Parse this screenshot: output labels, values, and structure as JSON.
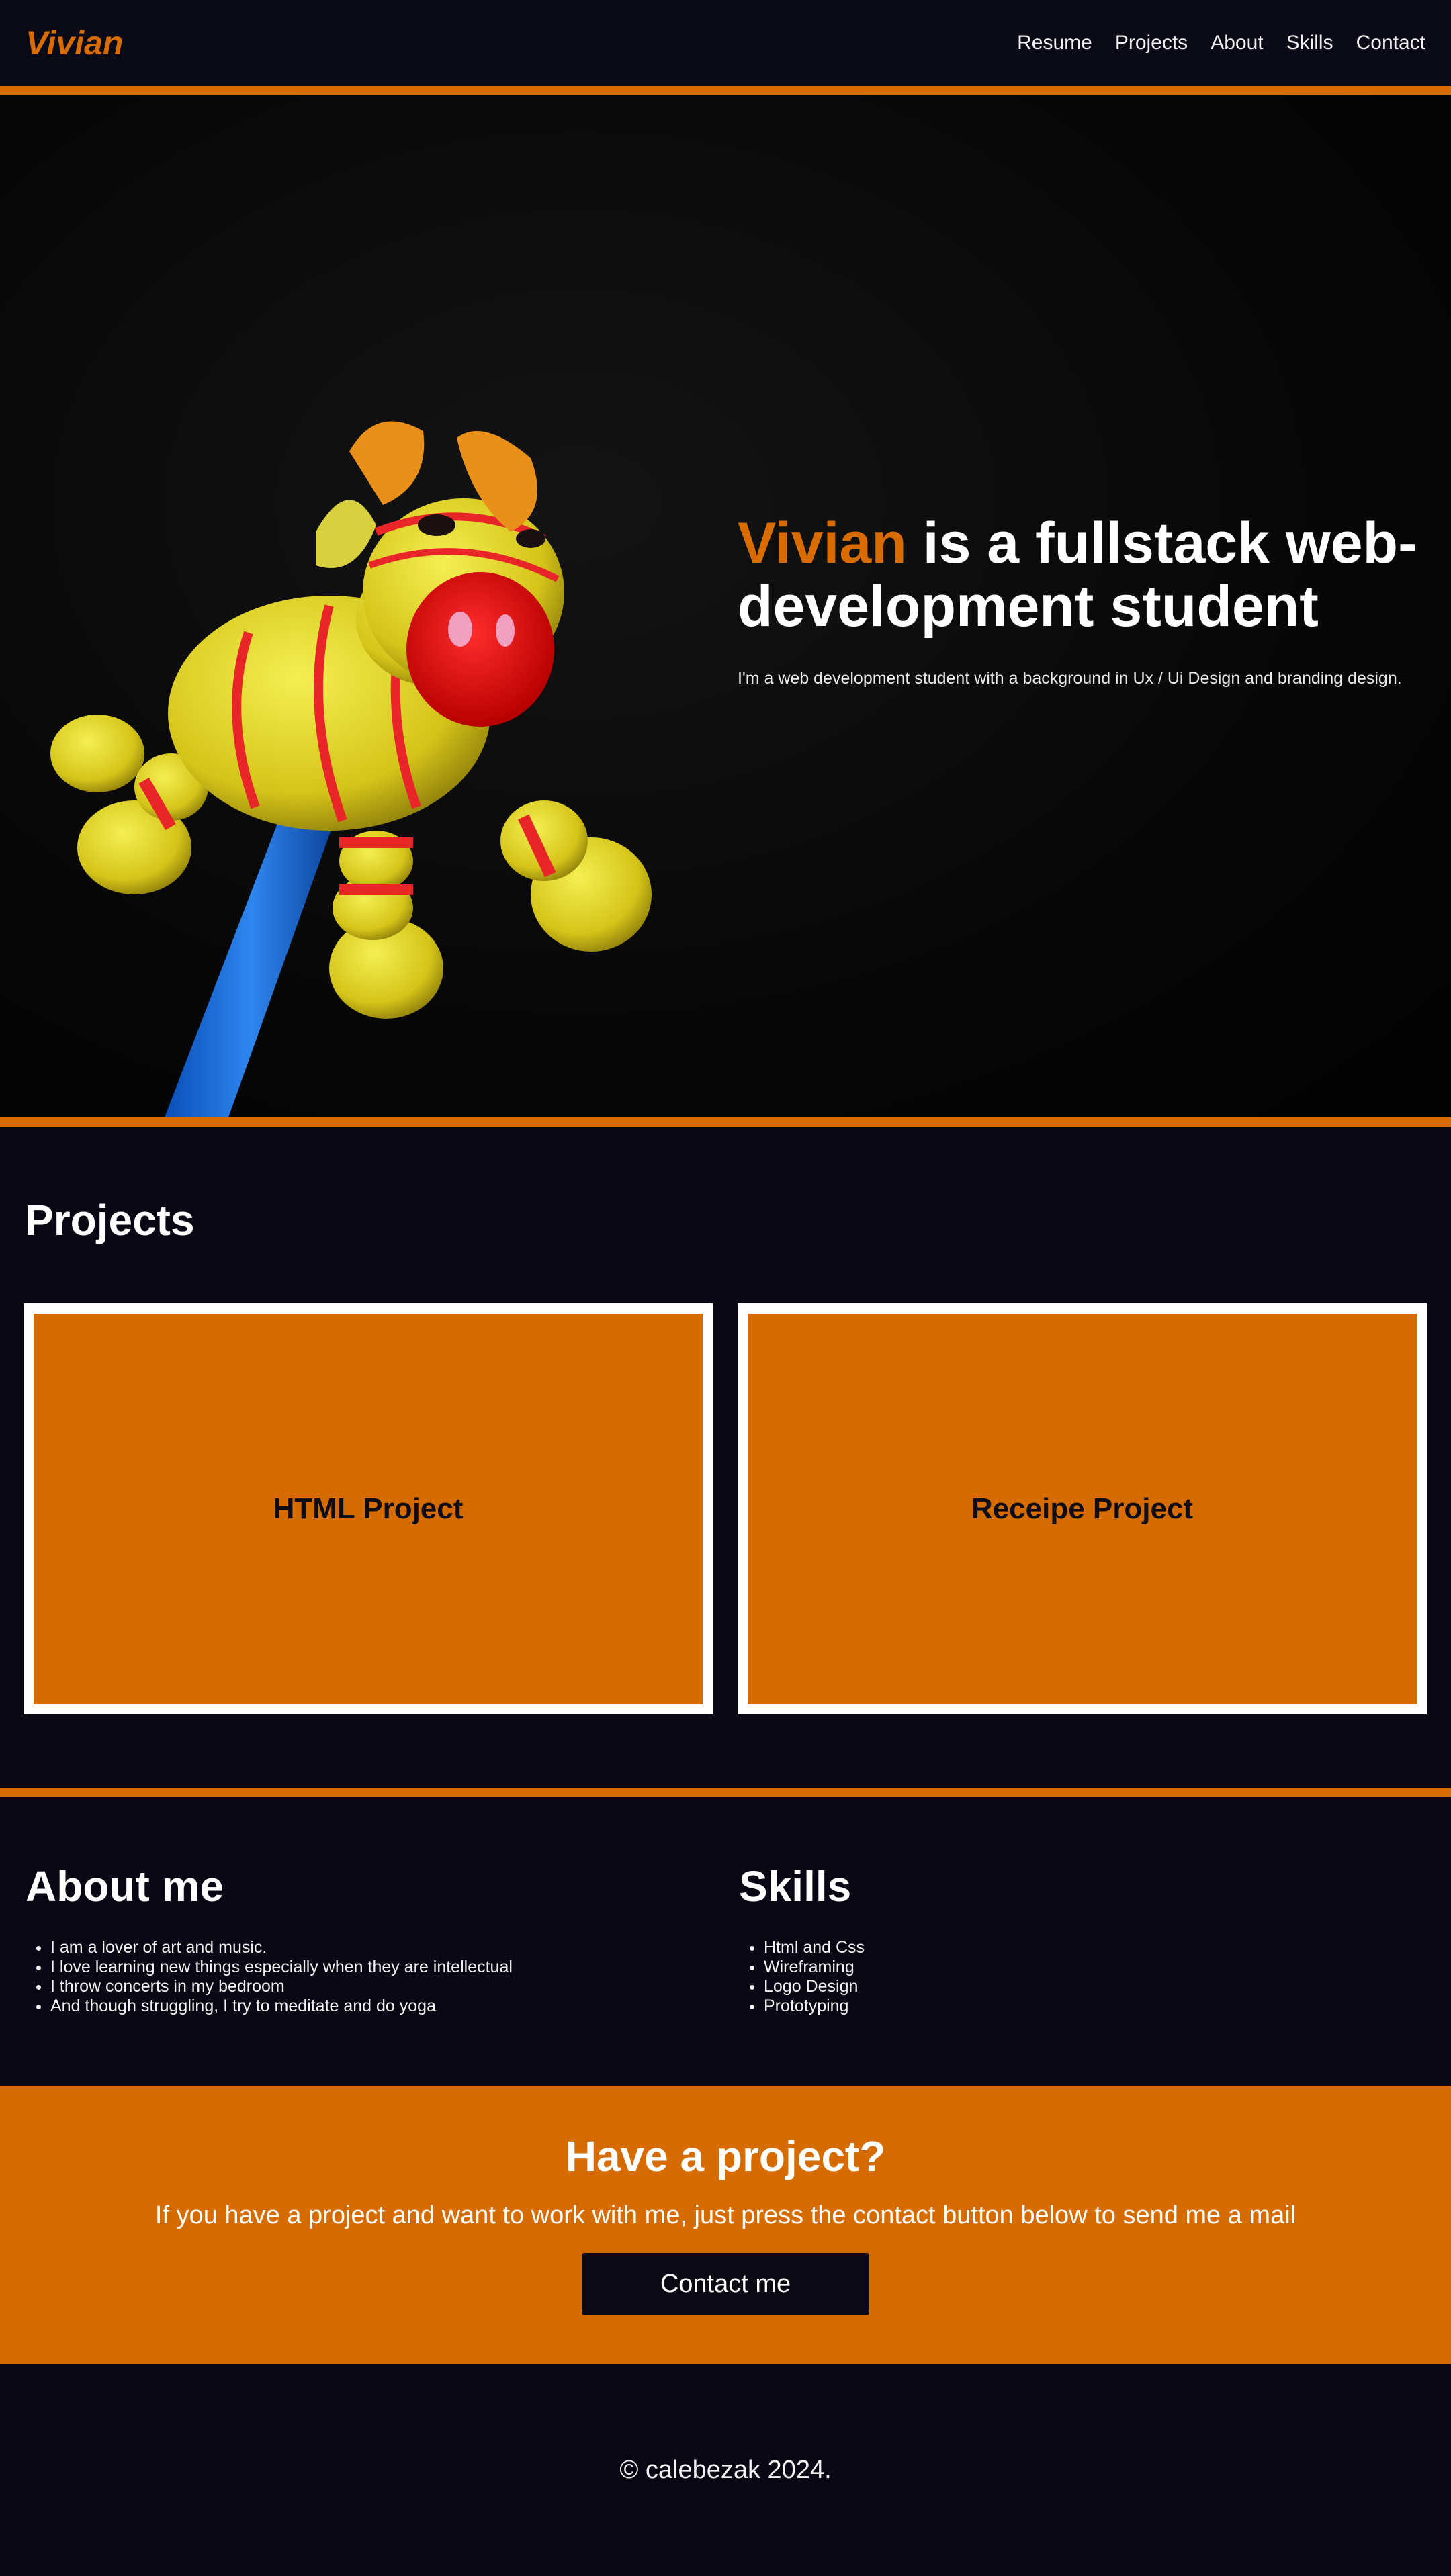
{
  "nav": {
    "logo": "Vivian",
    "links": [
      "Resume",
      "Projects",
      "About",
      "Skills",
      "Contact"
    ]
  },
  "hero": {
    "title_accent": "Vivian",
    "title_rest": " is a fullstack web-development student",
    "subtitle": "I'm a web development student with a background in Ux / Ui Design and branding design.",
    "image_icon": "wooden-toy-pencil-topper-image"
  },
  "projects": {
    "heading": "Projects",
    "cards": [
      {
        "title": "HTML Project"
      },
      {
        "title": "Receipe Project"
      }
    ]
  },
  "about": {
    "heading": "About me",
    "items": [
      "I am a lover of art and music.",
      "I love learning new things especially when they are intellectual",
      "I throw concerts in my bedroom",
      "And though struggling, I try to meditate and do yoga"
    ]
  },
  "skills": {
    "heading": "Skills",
    "items": [
      "Html and Css",
      "Wireframing",
      "Logo Design",
      "Prototyping"
    ]
  },
  "cta": {
    "heading": "Have a project?",
    "text": "If you have a project and want to work with me, just press the contact button below to send me a mail",
    "button": "Contact me"
  },
  "footer": {
    "copyright": "© calebezak 2024."
  },
  "colors": {
    "accent": "#d86c00",
    "background": "#080713",
    "card_border": "#ffffff",
    "button_bg": "#0b0a14"
  }
}
